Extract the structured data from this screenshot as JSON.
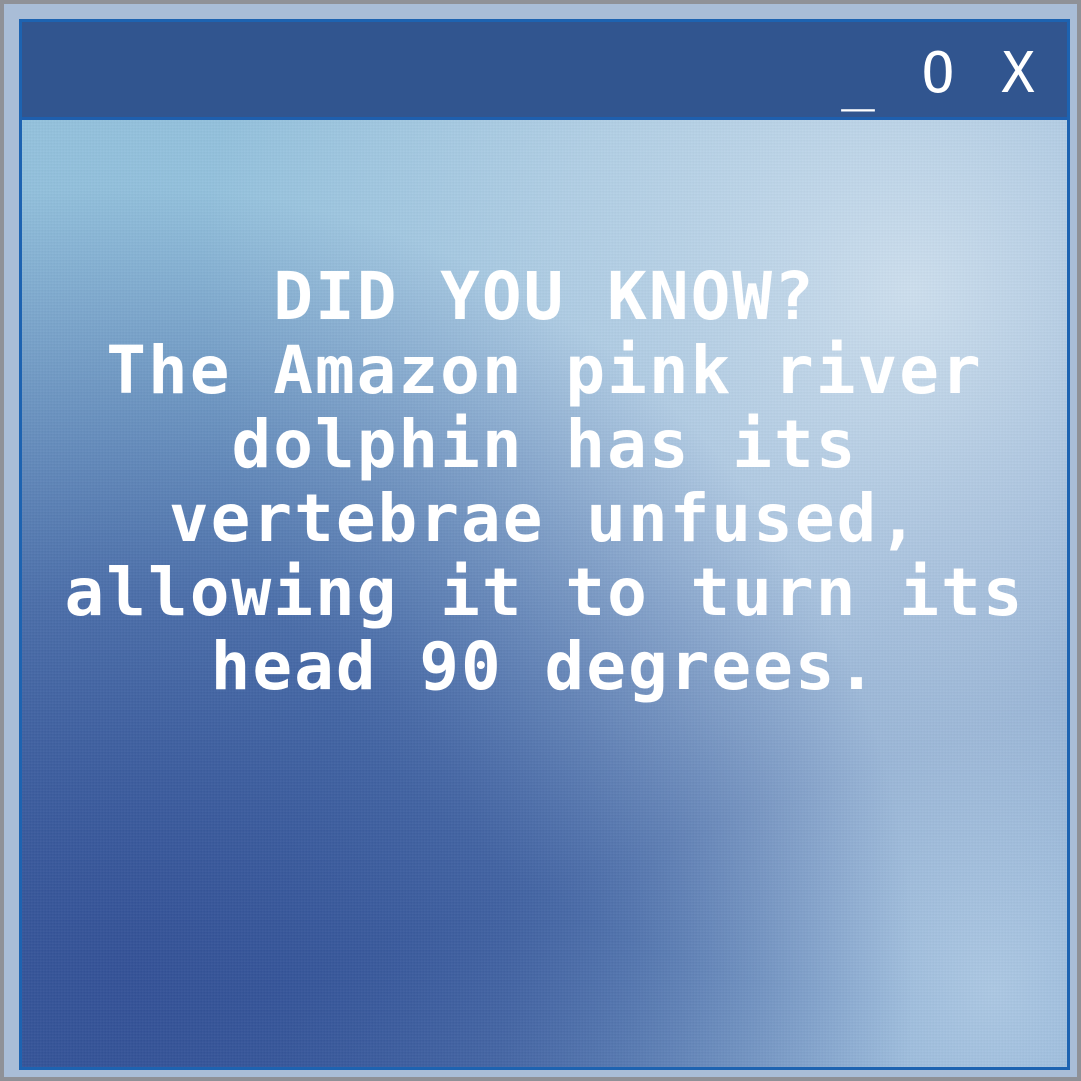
{
  "window": {
    "controls": {
      "minimize": "_",
      "maximize": "O",
      "close": "X"
    }
  },
  "message": {
    "heading": "DID YOU KNOW?",
    "lines": [
      "The Amazon pink river",
      "dolphin has its",
      "vertebrae unfused,",
      "allowing it to turn its",
      "head 90 degrees."
    ]
  },
  "colors": {
    "titlebar": "#31558f",
    "window_border": "#1d63b1",
    "outer_border": "#8f9197",
    "text": "#ffffff"
  }
}
